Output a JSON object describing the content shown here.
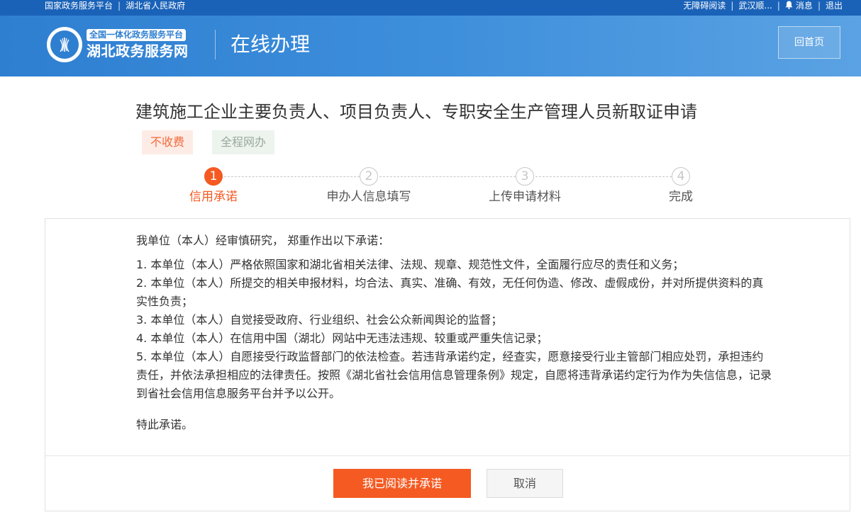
{
  "topbar": {
    "left_links": [
      "国家政务服务平台",
      "湖北省人民政府"
    ],
    "right_links": [
      "无障碍阅读",
      "武汉顺...",
      "消息",
      "退出"
    ]
  },
  "header": {
    "badge": "全国一体化政务服务平台",
    "site_name": "湖北政务服务网",
    "page_name": "在线办理",
    "home_button": "回首页"
  },
  "service": {
    "title": "建筑施工企业主要负责人、项目负责人、专职安全生产管理人员新取证申请",
    "tags": [
      "不收费",
      "全程网办"
    ]
  },
  "steps": [
    {
      "num": "1",
      "label": "信用承诺",
      "state": "active"
    },
    {
      "num": "2",
      "label": "申办人信息填写",
      "state": "todo"
    },
    {
      "num": "3",
      "label": "上传申请材料",
      "state": "todo"
    },
    {
      "num": "4",
      "label": "完成",
      "state": "todo"
    }
  ],
  "promise": {
    "intro": "我单位（本人）经审慎研究， 郑重作出以下承诺：",
    "items": [
      "1. 本单位（本人）严格依照国家和湖北省相关法律、法规、规章、规范性文件，全面履行应尽的责任和义务；",
      "2. 本单位（本人）所提交的相关申报材料，均合法、真实、准确、有效，无任何伪造、修改、虚假成份，并对所提供资料的真实性负责；",
      "3. 本单位（本人）自觉接受政府、行业组织、社会公众新闻舆论的监督；",
      "4. 本单位（本人）在信用中国（湖北）网站中无违法违规、较重或严重失信记录；",
      "5. 本单位（本人）自愿接受行政监督部门的依法检查。若违背承诺约定，经查实，愿意接受行业主管部门相应处罚，承担违约责任，并依法承担相应的法律责任。按照《湖北省社会信用信息管理条例》规定，自愿将违背承诺约定行为作为失信信息，记录到省社会信用信息服务平台并予以公开。"
    ],
    "closing": "特此承诺。"
  },
  "actions": {
    "agree": "我已阅读并承诺",
    "cancel": "取消"
  },
  "colors": {
    "primary_blue": "#2f7fd1",
    "accent_orange": "#f45a22"
  }
}
